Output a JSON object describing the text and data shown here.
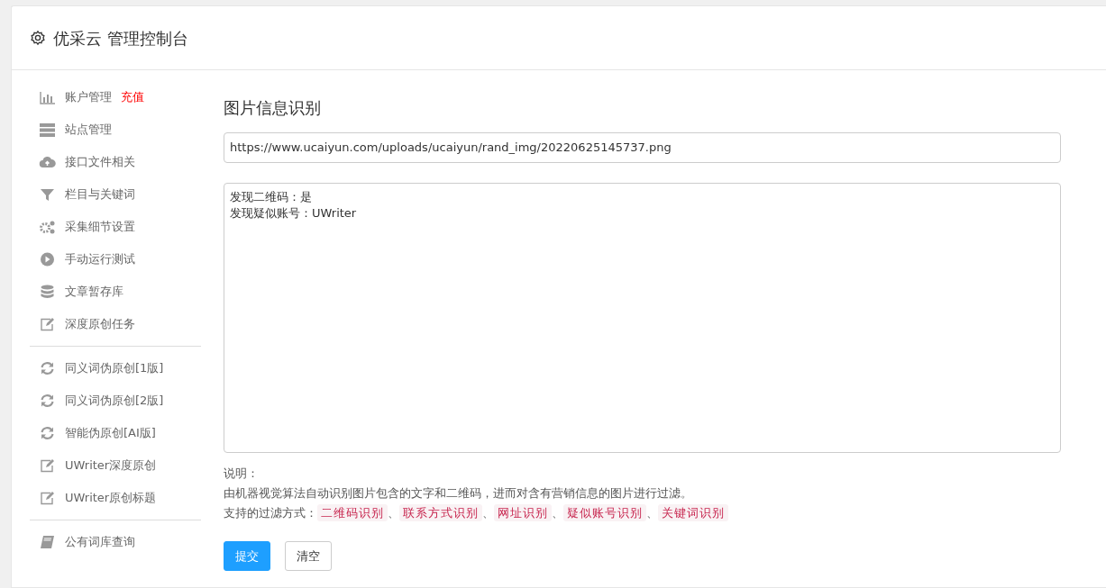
{
  "header": {
    "title": "优采云 管理控制台"
  },
  "sidebar": {
    "groups": [
      {
        "items": [
          {
            "label": "账户管理",
            "badge": "充值"
          },
          {
            "label": "站点管理"
          },
          {
            "label": "接口文件相关"
          },
          {
            "label": "栏目与关键词"
          },
          {
            "label": "采集细节设置"
          },
          {
            "label": "手动运行测试"
          },
          {
            "label": "文章暂存库"
          },
          {
            "label": "深度原创任务"
          }
        ]
      },
      {
        "items": [
          {
            "label": "同义词伪原创[1版]"
          },
          {
            "label": "同义词伪原创[2版]"
          },
          {
            "label": "智能伪原创[AI版]"
          },
          {
            "label": "UWriter深度原创"
          },
          {
            "label": "UWriter原创标题"
          }
        ]
      },
      {
        "items": [
          {
            "label": "公有词库查询"
          }
        ]
      }
    ]
  },
  "main": {
    "title": "图片信息识别",
    "url_field": {
      "value": "https://www.ucaiyun.com/uploads/ucaiyun/rand_img/20220625145737.png"
    },
    "result_box": {
      "lines": [
        "发现二维码：是",
        "发现疑似账号：UWriter"
      ]
    },
    "notes_heading": "说明：",
    "notes_text": "由机器视觉算法自动识别图片包含的文字和二维码，进而对含有营销信息的图片进行过滤。",
    "filters_label": "支持的过滤方式：",
    "filters": [
      "二维码识别",
      "联系方式识别",
      "网址识别",
      "疑似账号识别",
      "关键词识别"
    ],
    "filter_separator": "、",
    "buttons": [
      {
        "label": "提交",
        "kind": "primary"
      },
      {
        "label": "清空",
        "kind": "secondary"
      }
    ]
  }
}
